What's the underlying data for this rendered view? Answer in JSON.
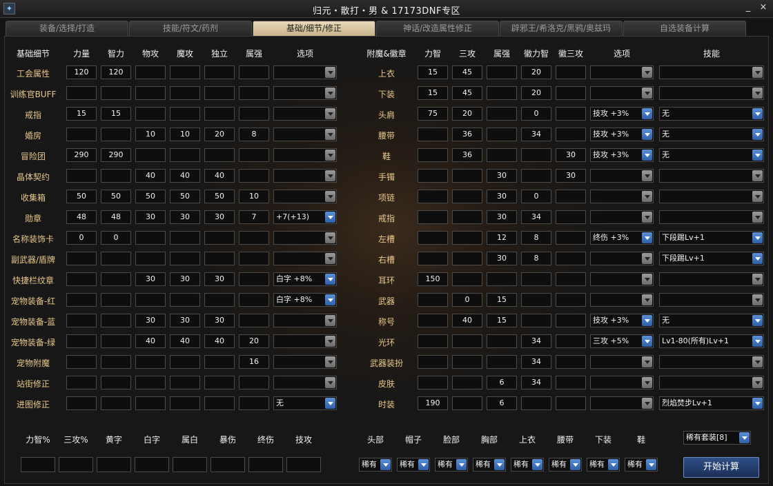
{
  "window": {
    "title": "归元・散打・男 & 17173DNF专区",
    "min_label": "_",
    "close_label": "×"
  },
  "tabs": [
    "装备/选择/打造",
    "技能/符文/药剂",
    "基础/细节/修正",
    "神话/改造属性修正",
    "辟邪王/希洛克/黑鸦/奥兹玛",
    "自选装备计算"
  ],
  "active_tab": 2,
  "left": {
    "headers": [
      "基础细节",
      "力量",
      "智力",
      "物攻",
      "魔攻",
      "独立",
      "属强",
      "选项"
    ],
    "rows": [
      {
        "label": "工会属性",
        "vals": [
          "120",
          "120",
          "",
          "",
          "",
          ""
        ],
        "opt": ""
      },
      {
        "label": "训练官BUFF",
        "vals": [
          "",
          "",
          "",
          "",
          "",
          ""
        ],
        "opt": ""
      },
      {
        "label": "戒指",
        "vals": [
          "15",
          "15",
          "",
          "",
          "",
          ""
        ],
        "opt": ""
      },
      {
        "label": "婚房",
        "vals": [
          "",
          "",
          "10",
          "10",
          "20",
          "8"
        ],
        "opt": ""
      },
      {
        "label": "冒险团",
        "vals": [
          "290",
          "290",
          "",
          "",
          "",
          ""
        ],
        "opt": ""
      },
      {
        "label": "晶体契约",
        "vals": [
          "",
          "",
          "40",
          "40",
          "40",
          ""
        ],
        "opt": ""
      },
      {
        "label": "收集箱",
        "vals": [
          "50",
          "50",
          "50",
          "50",
          "50",
          "10"
        ],
        "opt": ""
      },
      {
        "label": "勋章",
        "vals": [
          "48",
          "48",
          "30",
          "30",
          "30",
          "7"
        ],
        "opt": "+7(+13)"
      },
      {
        "label": "名称装饰卡",
        "vals": [
          "0",
          "0",
          "",
          "",
          "",
          ""
        ],
        "opt": ""
      },
      {
        "label": "副武器/盾牌",
        "vals": [
          "",
          "",
          "",
          "",
          "",
          ""
        ],
        "opt": ""
      },
      {
        "label": "快捷栏纹章",
        "vals": [
          "",
          "",
          "30",
          "30",
          "30",
          ""
        ],
        "opt": "白字 +8%"
      },
      {
        "label": "宠物装备-红",
        "vals": [
          "",
          "",
          "",
          "",
          "",
          ""
        ],
        "opt": "白字 +8%"
      },
      {
        "label": "宠物装备-蓝",
        "vals": [
          "",
          "",
          "30",
          "30",
          "30",
          ""
        ],
        "opt": ""
      },
      {
        "label": "宠物装备-绿",
        "vals": [
          "",
          "",
          "40",
          "40",
          "40",
          "20"
        ],
        "opt": ""
      },
      {
        "label": "宠物附魔",
        "vals": [
          "",
          "",
          "",
          "",
          "",
          "16"
        ],
        "opt": ""
      },
      {
        "label": "站街修正",
        "vals": [
          "",
          "",
          "",
          "",
          "",
          ""
        ],
        "opt": ""
      },
      {
        "label": "进图修正",
        "vals": [
          "",
          "",
          "",
          "",
          "",
          ""
        ],
        "opt": "无"
      }
    ]
  },
  "right": {
    "headers": [
      "附魔&徽章",
      "力智",
      "三攻",
      "属强",
      "徽力智",
      "徽三攻",
      "选项",
      "技能"
    ],
    "rows": [
      {
        "label": "上衣",
        "vals": [
          "15",
          "45",
          "",
          "20",
          ""
        ],
        "opt": "",
        "skill": ""
      },
      {
        "label": "下装",
        "vals": [
          "15",
          "45",
          "",
          "20",
          ""
        ],
        "opt": "",
        "skill": ""
      },
      {
        "label": "头肩",
        "vals": [
          "75",
          "20",
          "",
          "0",
          ""
        ],
        "opt": "技攻 +3%",
        "skill": "无"
      },
      {
        "label": "腰带",
        "vals": [
          "",
          "36",
          "",
          "34",
          ""
        ],
        "opt": "技攻 +3%",
        "skill": "无"
      },
      {
        "label": "鞋",
        "vals": [
          "",
          "36",
          "",
          "",
          "30"
        ],
        "opt": "技攻 +3%",
        "skill": "无"
      },
      {
        "label": "手镯",
        "vals": [
          "",
          "",
          "30",
          "",
          "30"
        ],
        "opt": "",
        "skill": ""
      },
      {
        "label": "项链",
        "vals": [
          "",
          "",
          "30",
          "0",
          ""
        ],
        "opt": "",
        "skill": ""
      },
      {
        "label": "戒指",
        "vals": [
          "",
          "",
          "30",
          "34",
          ""
        ],
        "opt": "",
        "skill": ""
      },
      {
        "label": "左槽",
        "vals": [
          "",
          "",
          "12",
          "8",
          ""
        ],
        "opt": "终伤 +3%",
        "skill": "下段踢Lv+1"
      },
      {
        "label": "右槽",
        "vals": [
          "",
          "",
          "30",
          "8",
          ""
        ],
        "opt": "",
        "skill": "下段踢Lv+1"
      },
      {
        "label": "耳环",
        "vals": [
          "150",
          "",
          "",
          "",
          ""
        ],
        "opt": "",
        "skill": ""
      },
      {
        "label": "武器",
        "vals": [
          "",
          "0",
          "15",
          "",
          ""
        ],
        "opt": "",
        "skill": ""
      },
      {
        "label": "称号",
        "vals": [
          "",
          "40",
          "15",
          "",
          ""
        ],
        "opt": "技攻 +3%",
        "skill": "无"
      },
      {
        "label": "光环",
        "vals": [
          "",
          "",
          "",
          "34",
          ""
        ],
        "opt": "三攻 +5%",
        "skill": "Lv1-80(所有)Lv+1"
      },
      {
        "label": "武器装扮",
        "vals": [
          "",
          "",
          "",
          "34",
          ""
        ],
        "opt": "",
        "skill": ""
      },
      {
        "label": "皮肤",
        "vals": [
          "",
          "",
          "6",
          "34",
          ""
        ],
        "opt": "",
        "skill": ""
      },
      {
        "label": "时装",
        "vals": [
          "190",
          "",
          "6",
          "",
          ""
        ],
        "opt": "",
        "skill": "烈焰焚步Lv+1"
      }
    ]
  },
  "bottom": {
    "stat_labels": [
      "力智%",
      "三攻%",
      "黄字",
      "白字",
      "属白",
      "暴伤",
      "终伤",
      "技攻"
    ],
    "stat_values": [
      "",
      "",
      "",
      "",
      "",
      "",
      "",
      ""
    ],
    "slot_labels": [
      "头部",
      "帽子",
      "脸部",
      "胸部",
      "上衣",
      "腰带",
      "下装",
      "鞋"
    ],
    "slot_values": [
      "稀有",
      "稀有",
      "稀有",
      "稀有",
      "稀有",
      "稀有",
      "稀有",
      "稀有"
    ],
    "set_select": "稀有套装[8]",
    "start_button": "开始计算"
  }
}
